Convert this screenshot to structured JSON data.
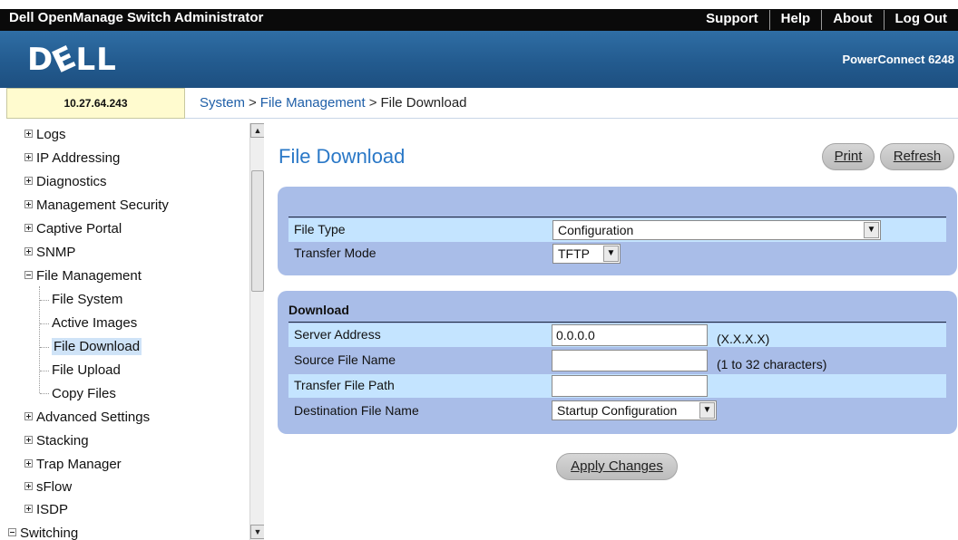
{
  "app": {
    "title": "Dell OpenManage Switch Administrator",
    "links": [
      "Support",
      "Help",
      "About",
      "Log Out"
    ],
    "logo": "DELL",
    "model": "PowerConnect 6248"
  },
  "ip": "10.27.64.243",
  "breadcrumb": {
    "system": "System",
    "file_management": "File Management",
    "current": "File Download",
    "separator": ">"
  },
  "sidebar": {
    "items": [
      {
        "label": "Logs"
      },
      {
        "label": "IP Addressing"
      },
      {
        "label": "Diagnostics"
      },
      {
        "label": "Management Security"
      },
      {
        "label": "Captive Portal"
      },
      {
        "label": "SNMP"
      },
      {
        "label": "File Management"
      },
      {
        "label": "File System"
      },
      {
        "label": "Active Images"
      },
      {
        "label": "File Download"
      },
      {
        "label": "File Upload"
      },
      {
        "label": "Copy Files"
      },
      {
        "label": "Advanced Settings"
      },
      {
        "label": "Stacking"
      },
      {
        "label": "Trap Manager"
      },
      {
        "label": "sFlow"
      },
      {
        "label": "ISDP"
      },
      {
        "label": "Switching"
      }
    ],
    "selected": "File Download"
  },
  "page": {
    "title": "File Download",
    "print_label": "Print",
    "refresh_label": "Refresh"
  },
  "file_settings": {
    "file_type_label": "File Type",
    "file_type_value": "Configuration",
    "transfer_mode_label": "Transfer Mode",
    "transfer_mode_value": "TFTP"
  },
  "download": {
    "title": "Download",
    "server_address_label": "Server Address",
    "server_address_value": "0.0.0.0",
    "server_address_hint": "(X.X.X.X)",
    "source_file_label": "Source File Name",
    "source_file_value": "",
    "source_file_hint": "(1 to 32 characters)",
    "transfer_path_label": "Transfer File Path",
    "transfer_path_value": "",
    "destination_label": "Destination File Name",
    "destination_value": "Startup Configuration"
  },
  "apply_label": "Apply Changes",
  "colors": {
    "panel": "#a9bde8",
    "row_highlight": "#c4e4ff",
    "title_blue": "#2a78c7",
    "link_blue": "#1f5fa8"
  }
}
